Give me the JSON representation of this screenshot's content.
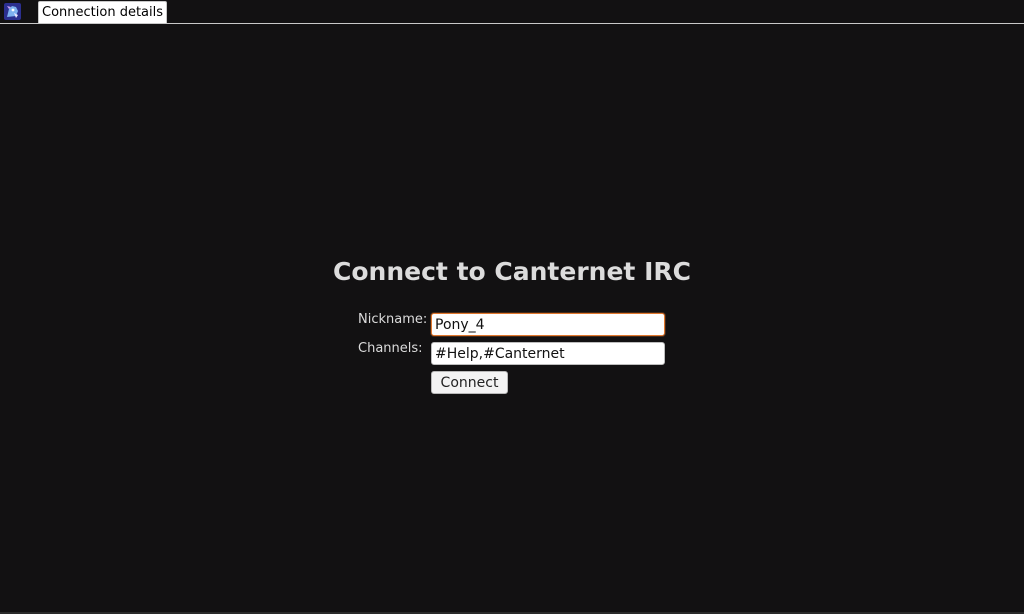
{
  "tabs": [
    {
      "label": "Connection details",
      "active": true
    }
  ],
  "logo": {
    "icon": "canternet-pony-logo-icon"
  },
  "form": {
    "title": "Connect to Canternet IRC",
    "nickname_label": "Nickname:",
    "nickname_value": "Pony_4",
    "channels_label": "Channels:",
    "channels_value": "#Help,#Canternet",
    "connect_label": "Connect"
  },
  "colors": {
    "background": "#121112",
    "focus_border": "#e1782e",
    "text": "#dcdcdc"
  }
}
